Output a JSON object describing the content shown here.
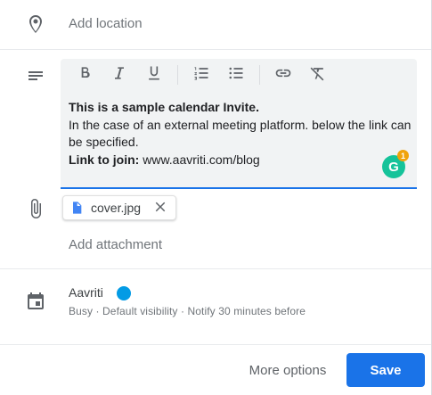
{
  "location": {
    "placeholder": "Add location"
  },
  "description": {
    "toolbar": [
      "bold-icon",
      "italic-icon",
      "underline-icon",
      "numbered-list-icon",
      "bulleted-list-icon",
      "link-icon",
      "remove-format-icon"
    ],
    "heading": "This is a sample calendar Invite.",
    "body": "In the case of an external meeting platform. below the link can be specified.",
    "link_label": "Link to join:",
    "link_value": " www.aavriti.com/blog",
    "grammarly_letter": "G",
    "grammarly_count": "1"
  },
  "attachment": {
    "file_name": "cover.jpg",
    "add_label": "Add attachment"
  },
  "calendar": {
    "name": "Aavriti",
    "color": "#039be5",
    "meta": "Busy · Default visibility · Notify 30 minutes before"
  },
  "footer": {
    "more_options": "More options",
    "save": "Save"
  },
  "colors": {
    "accent": "#1a73e8",
    "grammarly": "#15c39a"
  }
}
